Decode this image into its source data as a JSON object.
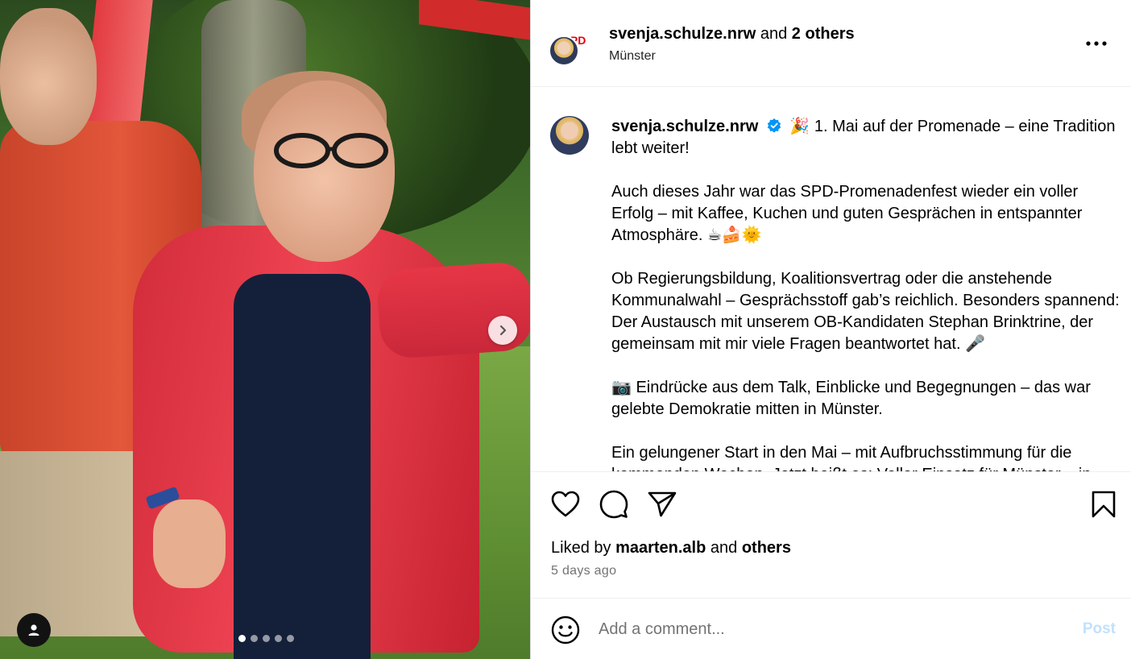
{
  "media": {
    "slide_count": 5,
    "active_slide": 1
  },
  "header": {
    "avatar_logo_text": "SPD",
    "username": "svenja.schulze.nrw",
    "and_text": "and",
    "others_text": "2 others",
    "location": "Münster"
  },
  "caption": {
    "username": "svenja.schulze.nrw",
    "paragraphs": [
      "🎉 1. Mai auf der Promenade – eine Tradition lebt weiter!",
      "Auch dieses Jahr war das SPD-Promenadenfest wieder ein voller Erfolg – mit Kaffee, Kuchen und guten Gesprächen in entspannter Atmosphäre. ☕🍰🌞",
      "Ob Regierungsbildung, Koalitionsvertrag oder die anstehende Kommunalwahl – Gesprächsstoff gab’s reichlich. Besonders spannend: Der Austausch mit unserem OB-Kandidaten Stephan Brinktrine, der gemeinsam mit mir viele Fragen beantwortet hat. 🎤",
      "📷 Eindrücke aus dem Talk, Einblicke und Begegnungen – das war gelebte Demokratie mitten in Münster.",
      "Ein gelungener Start in den Mai – mit Aufbruchsstimmung für die kommenden Wochen. Jetzt heißt es: Voller Einsatz für Münster – in"
    ]
  },
  "likes": {
    "prefix": "Liked by",
    "user": "maarten.alb",
    "middle": "and",
    "others": "others"
  },
  "timestamp": "5 days ago",
  "comment": {
    "placeholder": "Add a comment...",
    "post_label": "Post"
  },
  "colors": {
    "verified_blue": "#0095f6",
    "post_disabled": "#c2e1fb",
    "secondary_text": "#737373"
  }
}
